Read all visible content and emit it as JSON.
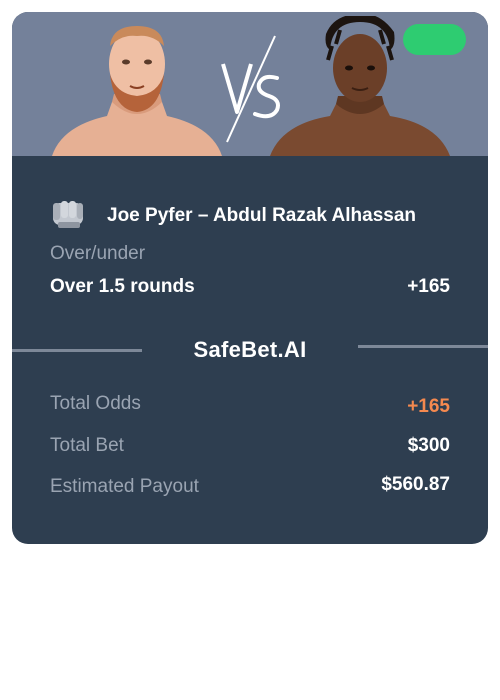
{
  "header": {
    "left_fighter_image": "fighter-portrait",
    "right_fighter_image": "fighter-portrait",
    "vs_text": "VS",
    "status_color": "#2ecc71"
  },
  "bet": {
    "matchup_icon": "boxing-glove-icon",
    "matchup": "Joe Pyfer – Abdul Razak Alhassan",
    "market_type": "Over/under",
    "selection": "Over 1.5 rounds",
    "selection_odds": "+165"
  },
  "brand": {
    "name": "SafeBet.AI"
  },
  "summary": {
    "total_odds_label": "Total Odds",
    "total_odds_value": "+165",
    "total_bet_label": "Total Bet",
    "total_bet_value": "$300",
    "payout_label": "Estimated Payout",
    "payout_value": "$560.87"
  },
  "colors": {
    "card_bg": "#2e3e50",
    "header_bg": "#74819a",
    "accent_odds": "#f5894f",
    "muted_text": "#9aa4b2"
  }
}
